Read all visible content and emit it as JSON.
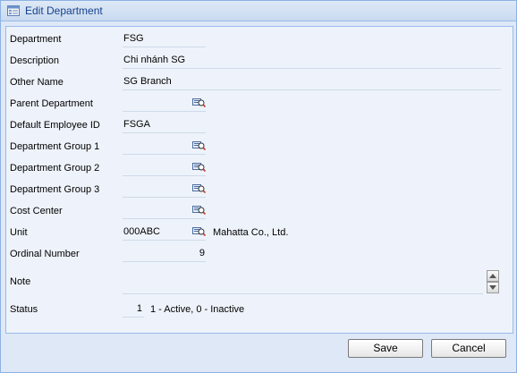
{
  "window": {
    "title": "Edit Department"
  },
  "form": {
    "department": {
      "label": "Department",
      "value": "FSG"
    },
    "description": {
      "label": "Description",
      "value": "Chi nhánh SG"
    },
    "other_name": {
      "label": "Other Name",
      "value": "SG Branch"
    },
    "parent_department": {
      "label": "Parent Department",
      "value": ""
    },
    "default_employee_id": {
      "label": "Default Employee ID",
      "value": "FSGA"
    },
    "department_group_1": {
      "label": "Department Group 1",
      "value": ""
    },
    "department_group_2": {
      "label": "Department Group 2",
      "value": ""
    },
    "department_group_3": {
      "label": "Department Group 3",
      "value": ""
    },
    "cost_center": {
      "label": "Cost Center",
      "value": ""
    },
    "unit": {
      "label": "Unit",
      "value": "000ABC",
      "description": "Mahatta Co., Ltd."
    },
    "ordinal_number": {
      "label": "Ordinal Number",
      "value": "9"
    },
    "note": {
      "label": "Note",
      "value": ""
    },
    "status": {
      "label": "Status",
      "value": "1",
      "hint": "1 - Active, 0 - Inactive"
    }
  },
  "buttons": {
    "save": "Save",
    "cancel": "Cancel"
  },
  "icons": {
    "title": "department-form-icon",
    "lookup": "lookup-search-icon"
  }
}
